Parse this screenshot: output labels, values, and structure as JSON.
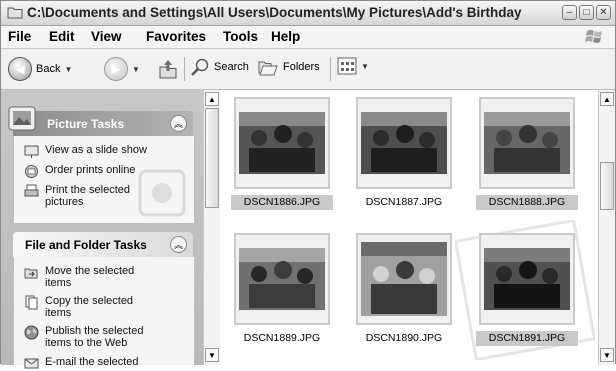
{
  "window": {
    "title": "C:\\Documents and Settings\\All Users\\Documents\\My Pictures\\Add's Birthday"
  },
  "menu": [
    "File",
    "Edit",
    "View",
    "Favorites",
    "Tools",
    "Help"
  ],
  "toolbar": {
    "back_label": "Back",
    "search_label": "Search",
    "folders_label": "Folders"
  },
  "picture_tasks": {
    "title": "Picture Tasks",
    "items": [
      "View as a slide show",
      "Order prints online",
      "Print the selected pictures"
    ]
  },
  "file_folder_tasks": {
    "title": "File and Folder Tasks",
    "items": [
      "Move the selected items",
      "Copy the selected items",
      "Publish the selected items to the Web",
      "E-mail the selected"
    ]
  },
  "files": [
    {
      "name": "DSCN1886.JPG",
      "selected": true
    },
    {
      "name": "DSCN1887.JPG",
      "selected": false
    },
    {
      "name": "DSCN1888.JPG",
      "selected": true
    },
    {
      "name": "DSCN1889.JPG",
      "selected": false
    },
    {
      "name": "DSCN1890.JPG",
      "selected": false
    },
    {
      "name": "DSCN1891.JPG",
      "selected": true
    }
  ],
  "icons": {
    "title": "folder-icon",
    "back": "back-arrow-icon",
    "forward": "forward-arrow-icon",
    "up": "up-folder-icon",
    "search": "search-icon",
    "folders": "folders-icon",
    "views": "views-icon"
  }
}
